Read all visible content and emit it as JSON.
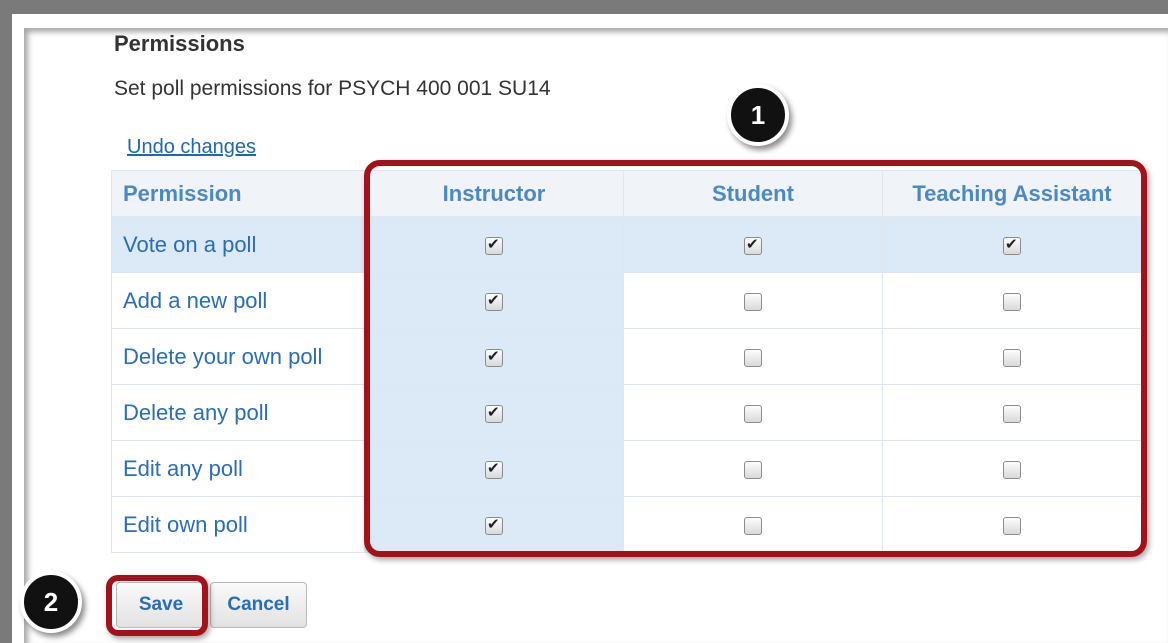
{
  "header": {
    "title": "Permissions",
    "subtitle": "Set poll permissions for PSYCH 400 001 SU14"
  },
  "undo_label": "Undo changes",
  "table": {
    "columns": [
      "Permission",
      "Instructor",
      "Student",
      "Teaching Assistant"
    ],
    "rows": [
      {
        "label": "Vote on a poll",
        "instructor": true,
        "student": true,
        "ta": true
      },
      {
        "label": "Add a new poll",
        "instructor": true,
        "student": false,
        "ta": false
      },
      {
        "label": "Delete your own poll",
        "instructor": true,
        "student": false,
        "ta": false
      },
      {
        "label": "Delete any poll",
        "instructor": true,
        "student": false,
        "ta": false
      },
      {
        "label": "Edit any poll",
        "instructor": true,
        "student": false,
        "ta": false
      },
      {
        "label": "Edit own poll",
        "instructor": true,
        "student": false,
        "ta": false
      }
    ]
  },
  "buttons": {
    "save": "Save",
    "cancel": "Cancel"
  },
  "annotations": {
    "badge1": "1",
    "badge2": "2",
    "color": "#a3121a"
  }
}
